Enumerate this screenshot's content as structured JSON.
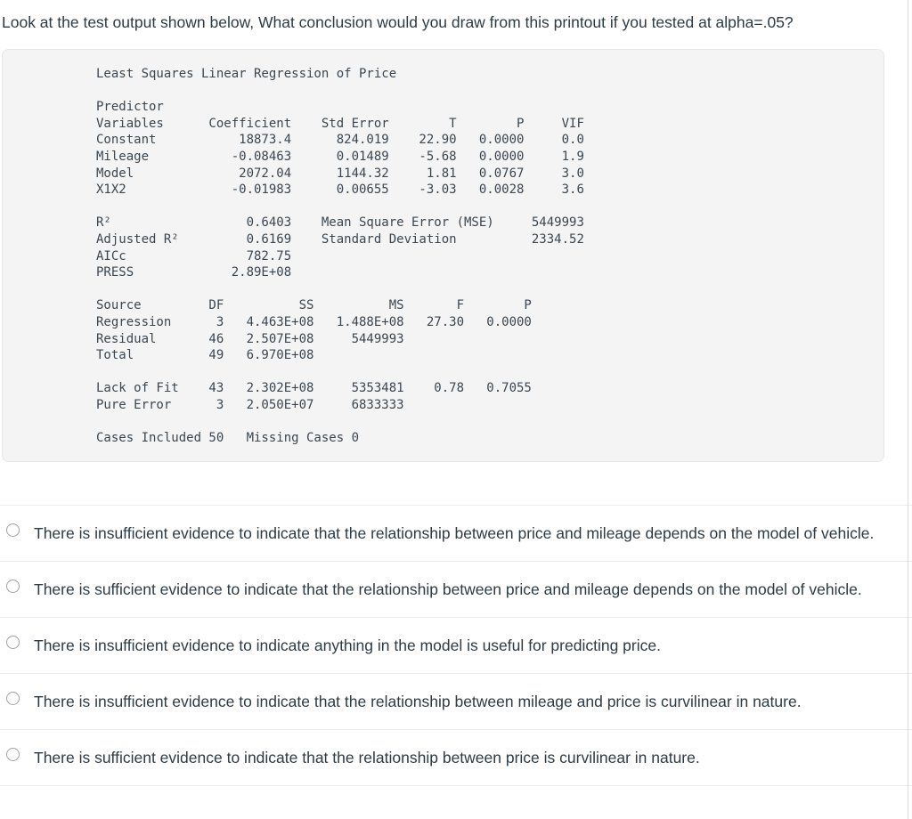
{
  "question": {
    "stem": "Look at the test output shown below, What conclusion would you draw from this printout if you tested at alpha=.05?"
  },
  "colors": {
    "page_background": "#ffffff",
    "panel_background": "#f4f4f4",
    "panel_border": "#e6e6e6",
    "text": "#2d3b45",
    "mono_text": "#3c4650",
    "separator": "#e8eaec",
    "radio_border": "#9aa3ab"
  },
  "printout": {
    "title": "Least Squares Linear Regression of Price",
    "predictor_header_line1": "Predictor",
    "predictor_columns": [
      "Variables",
      "Coefficient",
      "Std Error",
      "T",
      "P",
      "VIF"
    ],
    "predictor_rows": [
      {
        "variable": "Constant",
        "coefficient": "18873.4",
        "std_error": "824.019",
        "t": "22.90",
        "p": "0.0000",
        "vif": "0.0"
      },
      {
        "variable": "Mileage",
        "coefficient": "-0.08463",
        "std_error": "0.01489",
        "t": "-5.68",
        "p": "0.0000",
        "vif": "1.9"
      },
      {
        "variable": "Model",
        "coefficient": "2072.04",
        "std_error": "1144.32",
        "t": "1.81",
        "p": "0.0767",
        "vif": "3.0"
      },
      {
        "variable": "X1X2",
        "coefficient": "-0.01983",
        "std_error": "0.00655",
        "t": "-3.03",
        "p": "0.0028",
        "vif": "3.6"
      }
    ],
    "fit_statistics": [
      {
        "label": "R²",
        "value": "0.6403",
        "label2": "Mean Square Error (MSE)",
        "value2": "5449993"
      },
      {
        "label": "Adjusted R²",
        "value": "0.6169",
        "label2": "Standard Deviation",
        "value2": "2334.52"
      },
      {
        "label": "AICc",
        "value": "782.75",
        "label2": "",
        "value2": ""
      },
      {
        "label": "PRESS",
        "value": "2.89E+08",
        "label2": "",
        "value2": ""
      }
    ],
    "anova_columns": [
      "Source",
      "DF",
      "SS",
      "MS",
      "F",
      "P"
    ],
    "anova_rows": [
      {
        "source": "Regression",
        "df": "3",
        "ss": "4.463E+08",
        "ms": "1.488E+08",
        "f": "27.30",
        "p": "0.0000"
      },
      {
        "source": "Residual",
        "df": "46",
        "ss": "2.507E+08",
        "ms": "5449993",
        "f": "",
        "p": ""
      },
      {
        "source": "Total",
        "df": "49",
        "ss": "6.970E+08",
        "ms": "",
        "f": "",
        "p": ""
      }
    ],
    "lack_of_fit_rows": [
      {
        "source": "Lack of Fit",
        "df": "43",
        "ss": "2.302E+08",
        "ms": "5353481",
        "f": "0.78",
        "p": "0.7055"
      },
      {
        "source": "Pure Error",
        "df": "3",
        "ss": "2.050E+07",
        "ms": "6833333",
        "f": "",
        "p": ""
      }
    ],
    "cases_included_label": "Cases Included",
    "cases_included": "50",
    "missing_cases_label": "Missing Cases",
    "missing_cases": "0",
    "raw": "Least Squares Linear Regression of Price\n\nPredictor\nVariables      Coefficient    Std Error        T        P     VIF\nConstant           18873.4      824.019    22.90   0.0000     0.0\nMileage           -0.08463      0.01489    -5.68   0.0000     1.9\nModel              2072.04      1144.32     1.81   0.0767     3.0\nX1X2              -0.01983      0.00655    -3.03   0.0028     3.6\n\nR²                  0.6403    Mean Square Error (MSE)     5449993\nAdjusted R²         0.6169    Standard Deviation          2334.52\nAICc                782.75\nPRESS             2.89E+08\n\nSource         DF          SS          MS       F        P\nRegression      3   4.463E+08   1.488E+08   27.30   0.0000\nResidual       46   2.507E+08     5449993\nTotal          49   6.970E+08\n\nLack of Fit    43   2.302E+08     5353481    0.78   0.7055\nPure Error      3   2.050E+07     6833333\n\nCases Included 50   Missing Cases 0"
  },
  "answers": {
    "options": [
      {
        "id": "option-a",
        "label": "There is insufficient evidence to indicate that the relationship between price and mileage depends on the model of vehicle.",
        "selected": false
      },
      {
        "id": "option-b",
        "label": "There is sufficient evidence to indicate that the relationship between price and mileage depends on the model of vehicle.",
        "selected": false
      },
      {
        "id": "option-c",
        "label": "There is insufficient evidence to indicate anything in the model is useful for predicting price.",
        "selected": false
      },
      {
        "id": "option-d",
        "label": "There is insufficient evidence to indicate that the relationship between mileage and price is curvilinear in nature.",
        "selected": false
      },
      {
        "id": "option-e",
        "label": "There is sufficient evidence to indicate that the relationship between price is curvilinear in nature.",
        "selected": false
      }
    ]
  }
}
